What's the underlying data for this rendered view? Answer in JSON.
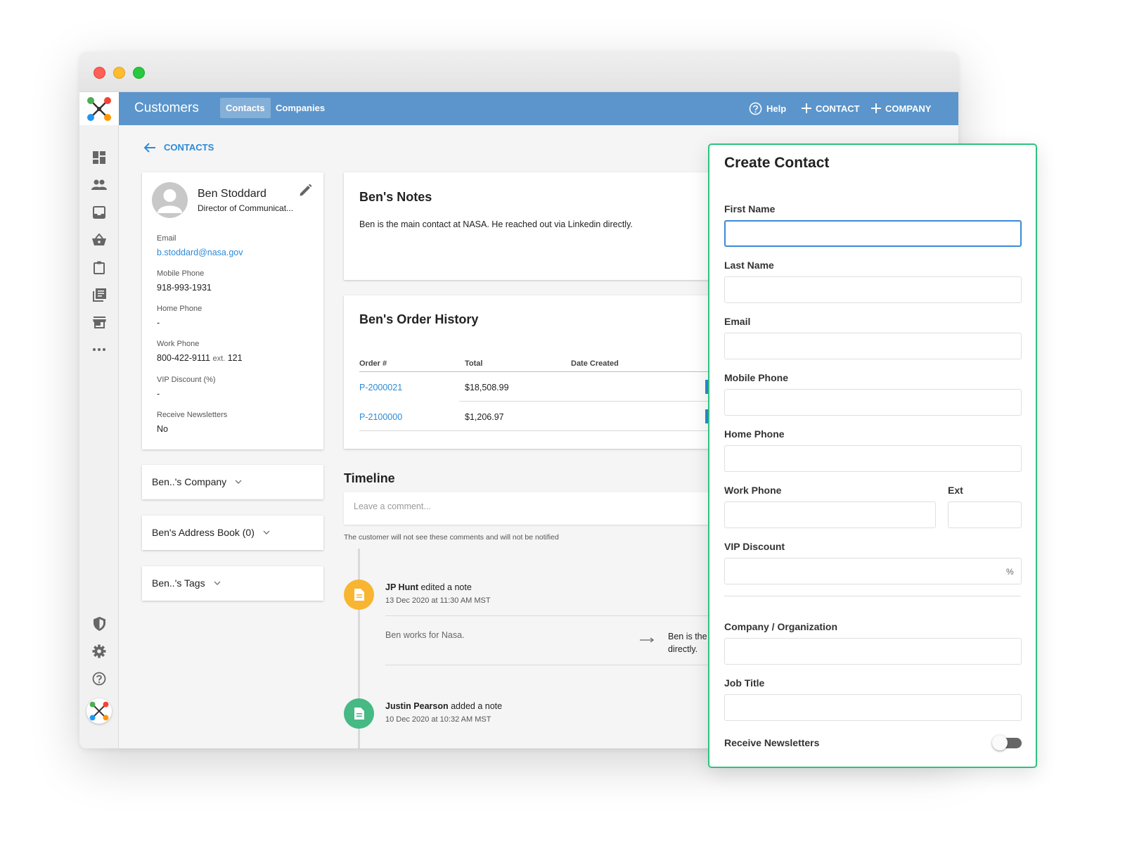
{
  "app": {
    "title": "Customers",
    "tabs": [
      {
        "label": "Contacts",
        "active": true
      },
      {
        "label": "Companies",
        "active": false
      }
    ],
    "actions": {
      "help": "Help",
      "contact": "CONTACT",
      "company": "COMPANY"
    }
  },
  "sidebar": {
    "icons": [
      "dashboard-icon",
      "people-icon",
      "inbox-icon",
      "basket-icon",
      "clipboard-icon",
      "library-icon",
      "store-icon",
      "more-icon",
      "shield-icon",
      "gear-icon",
      "help-circle-icon",
      "app-logo-icon"
    ]
  },
  "breadcrumb": {
    "back_label": "CONTACTS"
  },
  "contact": {
    "name": "Ben Stoddard",
    "job_title": "Director of Communicat...",
    "fields": [
      {
        "label": "Email",
        "value": "b.stoddard@nasa.gov",
        "link": true
      },
      {
        "label": "Mobile Phone",
        "value": "918-993-1931"
      },
      {
        "label": "Home Phone",
        "value": "-"
      },
      {
        "label": "Work Phone",
        "value": "800-422-9111",
        "ext_label": "ext.",
        "ext": "121"
      },
      {
        "label": "VIP Discount (%)",
        "value": "-"
      },
      {
        "label": "Receive Newsletters",
        "value": "No"
      }
    ]
  },
  "accordions": [
    {
      "label": "Ben..'s Company"
    },
    {
      "label": "Ben's Address Book (0)"
    },
    {
      "label": "Ben..'s Tags"
    }
  ],
  "notes": {
    "title": "Ben's Notes",
    "text": "Ben is the main contact at NASA. He reached out via Linkedin directly."
  },
  "orders": {
    "title": "Ben's Order History",
    "columns": [
      "Order #",
      "Total",
      "Date Created"
    ],
    "rows": [
      {
        "order": "P-2000021",
        "total": "$18,508.99"
      },
      {
        "order": "P-2100000",
        "total": "$1,206.97"
      }
    ]
  },
  "timeline": {
    "title": "Timeline",
    "comment_placeholder": "Leave a comment...",
    "helper": "The customer will not see these comments and will not be notified",
    "entries": [
      {
        "user": "JP Hunt",
        "action": "edited a note",
        "date": "13 Dec 2020 at 11:30 AM MST",
        "old": "Ben works for Nasa.",
        "new_line1": "Ben is the r",
        "new_line2": "directly."
      },
      {
        "user": "Justin Pearson",
        "action": "added a note",
        "date": "10 Dec 2020 at 10:32 AM MST"
      }
    ]
  },
  "create_contact": {
    "title": "Create Contact",
    "labels": {
      "first_name": "First Name",
      "last_name": "Last Name",
      "email": "Email",
      "mobile_phone": "Mobile Phone",
      "home_phone": "Home Phone",
      "work_phone": "Work Phone",
      "ext": "Ext",
      "vip_discount": "VIP Discount",
      "company": "Company / Organization",
      "job_title": "Job Title",
      "newsletters": "Receive Newsletters"
    },
    "vip_suffix": "%",
    "newsletters_on": false
  },
  "colors": {
    "topbar": "#5b95cb",
    "link": "#2d8ad6",
    "panel_border": "#2ec27e",
    "timeline_orange": "#f8b532",
    "timeline_green": "#46b984"
  }
}
